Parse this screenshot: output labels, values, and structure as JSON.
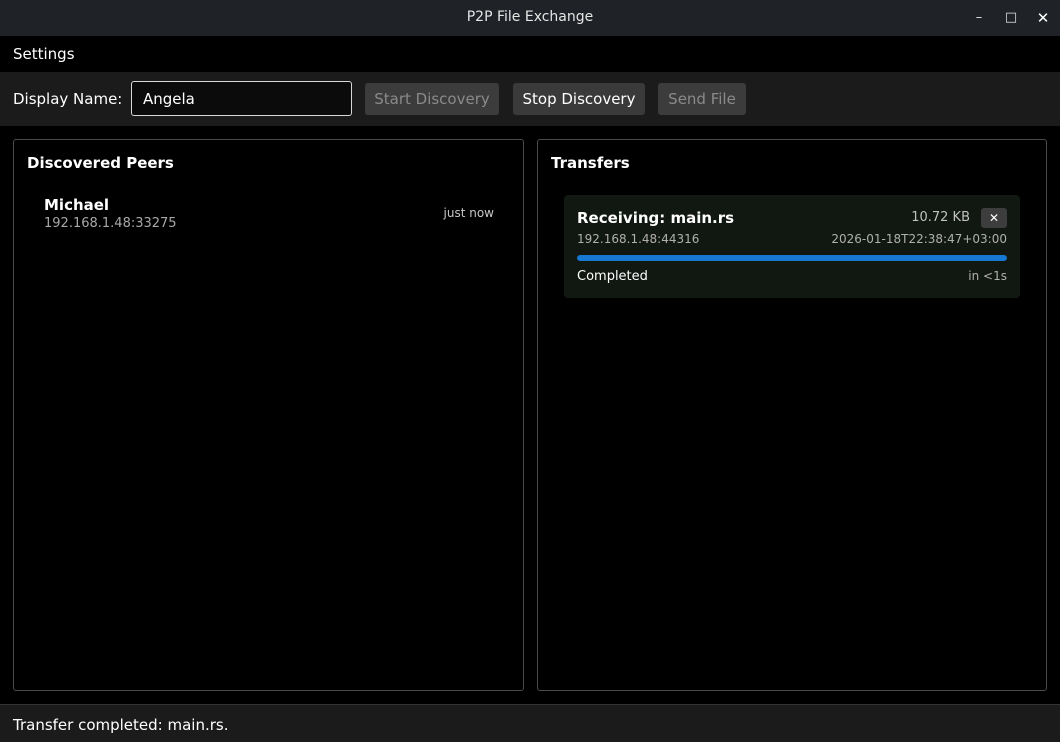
{
  "window": {
    "title": "P2P File Exchange",
    "minimize_glyph": "–",
    "maximize_glyph": "□",
    "close_glyph": "✕"
  },
  "menubar": {
    "items": [
      "Settings"
    ]
  },
  "toolbar": {
    "display_name_label": "Display Name:",
    "display_name_value": "Angela",
    "start_label": "Start Discovery",
    "stop_label": "Stop Discovery",
    "send_label": "Send File"
  },
  "peers_panel": {
    "title": "Discovered Peers",
    "peers": [
      {
        "name": "Michael",
        "address": "192.168.1.48:33275",
        "last_seen": "just now"
      }
    ]
  },
  "transfers_panel": {
    "title": "Transfers",
    "transfers": [
      {
        "title": "Receiving: main.rs",
        "size": "10.72 KB",
        "cancel_glyph": "✕",
        "peer": "192.168.1.48:44316",
        "timestamp": "2026-01-18T22:38:47+03:00",
        "progress_percent": 100,
        "status": "Completed",
        "eta": "in <1s"
      }
    ]
  },
  "statusbar": {
    "text": "Transfer completed: main.rs."
  },
  "colors": {
    "accent": "#1778d4",
    "card_bg": "#111711"
  }
}
